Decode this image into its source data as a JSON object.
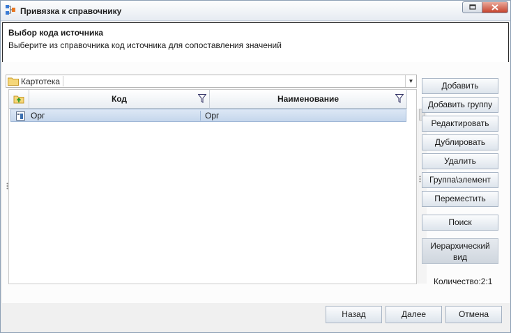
{
  "window": {
    "title": "Привязка к справочнику"
  },
  "header": {
    "title": "Выбор кода источника",
    "subtitle": "Выберите из справочника код источника для сопоставления значений"
  },
  "path": {
    "label": "Картотека",
    "value": ""
  },
  "grid": {
    "columns": [
      "Код",
      "Наименование"
    ],
    "rows": [
      {
        "code": "Орг",
        "name": "Орг"
      }
    ]
  },
  "sidebar": {
    "add": "Добавить",
    "add_group": "Добавить группу",
    "edit": "Редактировать",
    "duplicate": "Дублировать",
    "delete": "Удалить",
    "group_element": "Группа\\элемент",
    "move": "Переместить",
    "search": "Поиск",
    "hierarchy_line1": "Иерархический",
    "hierarchy_line2": "вид"
  },
  "count": "Количество:2:1",
  "footer": {
    "back": "Назад",
    "next": "Далее",
    "cancel": "Отмена"
  }
}
